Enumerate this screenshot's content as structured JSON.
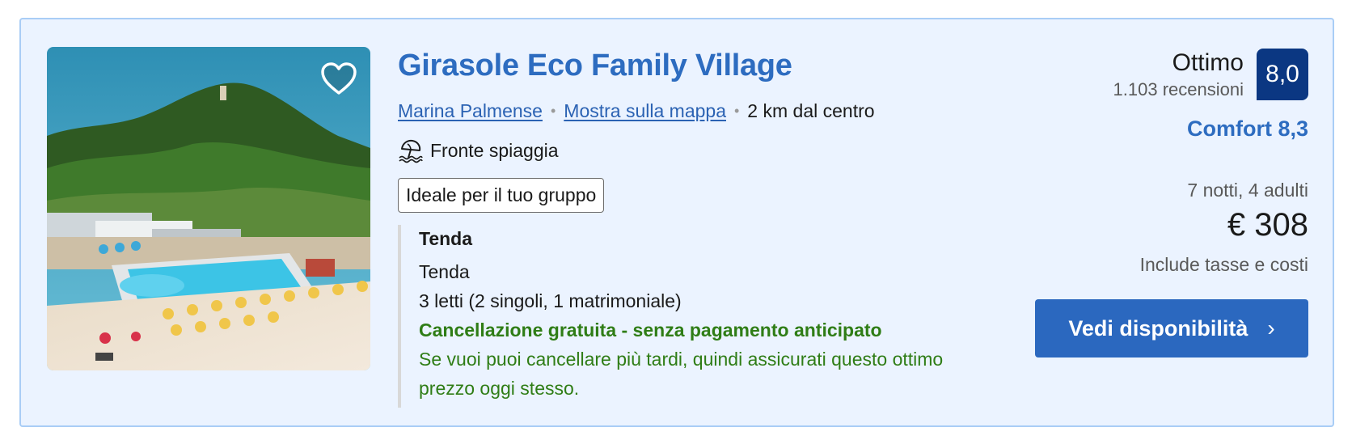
{
  "property": {
    "name": "Girasole Eco Family Village",
    "location_link": "Marina Palmense",
    "map_link": "Mostra sulla mappa",
    "distance": "2 km dal centro",
    "beach_label": "Fronte spiaggia",
    "badge": "Ideale per il tuo gruppo"
  },
  "room": {
    "type_title": "Tenda",
    "type": "Tenda",
    "beds": "3 letti (2 singoli, 1 matrimoniale)",
    "cancellation_title": "Cancellazione gratuita - senza pagamento anticipato",
    "cancellation_text": "Se vuoi puoi cancellare più tardi, quindi assicurati questo ottimo prezzo oggi stesso."
  },
  "rating": {
    "word": "Ottimo",
    "reviews": "1.103 recensioni",
    "score": "8,0",
    "comfort": "Comfort 8,3"
  },
  "pricing": {
    "stay": "7 notti, 4 adulti",
    "price": "€ 308",
    "taxes": "Include tasse e costi"
  },
  "actions": {
    "cta_label": "Vedi disponibilità"
  },
  "icons": {
    "favorite": "heart-icon",
    "beach": "beach-umbrella-icon",
    "cta_chevron": "chevron-right-icon"
  },
  "colors": {
    "link": "#2b62b3",
    "title": "#2d6cc0",
    "score_bg": "#0b3782",
    "cta_bg": "#2b68bf",
    "cancel_green": "#2f7d16",
    "card_bg": "#ebf3ff"
  }
}
